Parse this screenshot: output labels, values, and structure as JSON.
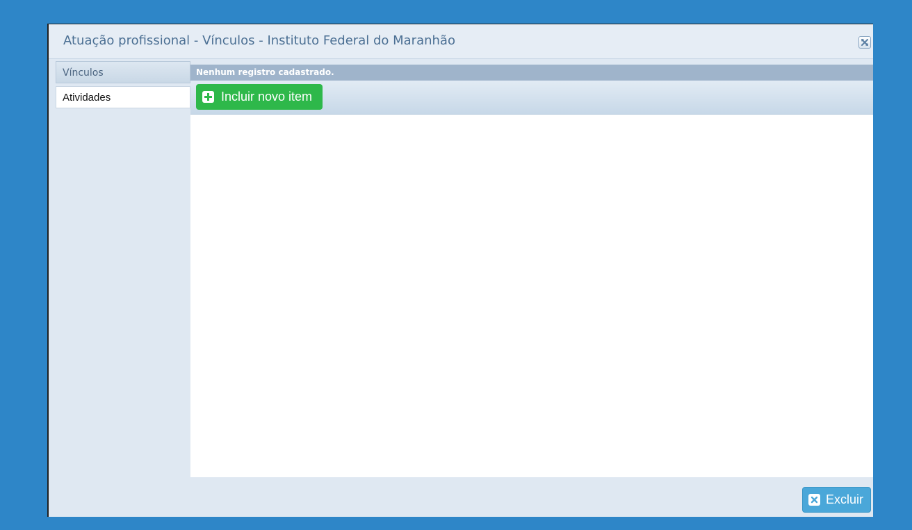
{
  "dialog": {
    "title": "Atuação profissional - Vínculos - Instituto Federal do Maranhão",
    "close_icon": "close-icon"
  },
  "sidebar": {
    "tabs": [
      {
        "label": "Vínculos",
        "active": true
      },
      {
        "label": "Atividades",
        "active": false
      }
    ]
  },
  "main": {
    "empty_message": "Nenhum registro cadastrado.",
    "add_button_label": "Incluir novo item",
    "add_icon": "plus-icon"
  },
  "footer": {
    "delete_button_label": "Excluir",
    "delete_icon": "x-icon"
  },
  "colors": {
    "background": "#2e86c8",
    "add_button": "#2eb84a",
    "delete_button": "#4aa7d9",
    "empty_bar": "#9fb4cb"
  }
}
